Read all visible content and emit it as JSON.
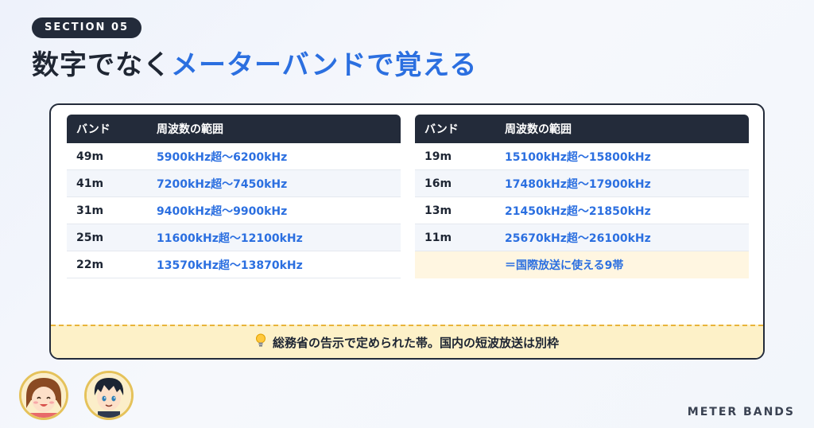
{
  "header": {
    "section_label": "SECTION 05",
    "title_plain": "数字でなく",
    "title_accent": "メーターバンドで覚える"
  },
  "columns": {
    "band": "バンド",
    "range": "周波数の範囲"
  },
  "left_rows": [
    {
      "band": "49m",
      "range": "5900kHz超〜6200kHz"
    },
    {
      "band": "41m",
      "range": "7200kHz超〜7450kHz"
    },
    {
      "band": "31m",
      "range": "9400kHz超〜9900kHz"
    },
    {
      "band": "25m",
      "range": "11600kHz超〜12100kHz"
    },
    {
      "band": "22m",
      "range": "13570kHz超〜13870kHz"
    }
  ],
  "right_rows": [
    {
      "band": "19m",
      "range": "15100kHz超〜15800kHz"
    },
    {
      "band": "16m",
      "range": "17480kHz超〜17900kHz"
    },
    {
      "band": "13m",
      "range": "21450kHz超〜21850kHz"
    },
    {
      "band": "11m",
      "range": "25670kHz超〜26100kHz"
    }
  ],
  "note_row": "＝国際放送に使える9帯",
  "footer_note": "総務省の告示で定められた帯。国内の短波放送は別枠",
  "footer_icon": "lightbulb-icon",
  "brand": "METER BANDS",
  "colors": {
    "accent": "#2b6fe0",
    "dark": "#232b3a",
    "note_bg": "#fff6e1",
    "footer_bg": "#fdf1c8"
  }
}
